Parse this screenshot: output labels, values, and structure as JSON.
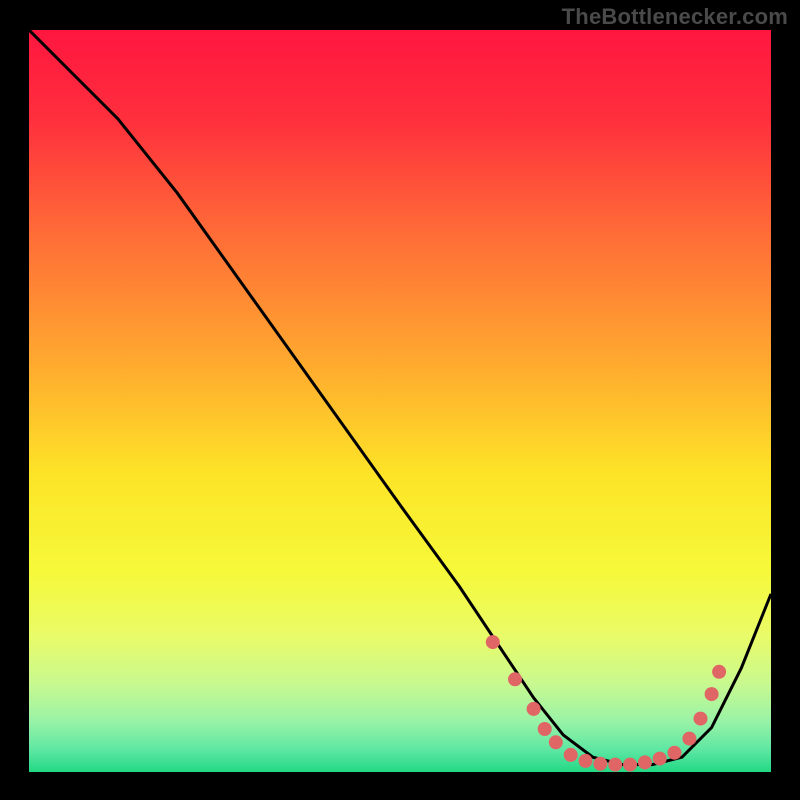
{
  "attribution": "TheBottlenecker.com",
  "chart_data": {
    "type": "line",
    "title": "",
    "xlabel": "",
    "ylabel": "",
    "xlim": [
      0,
      100
    ],
    "ylim": [
      0,
      100
    ],
    "background_gradient_stops": [
      {
        "offset": 0,
        "color": "#ff163f"
      },
      {
        "offset": 12,
        "color": "#ff2f3d"
      },
      {
        "offset": 28,
        "color": "#ff6e37"
      },
      {
        "offset": 45,
        "color": "#ffaa2f"
      },
      {
        "offset": 60,
        "color": "#fde427"
      },
      {
        "offset": 73,
        "color": "#f6f93a"
      },
      {
        "offset": 82,
        "color": "#e8fb6a"
      },
      {
        "offset": 88,
        "color": "#c9f98f"
      },
      {
        "offset": 93,
        "color": "#9bf3a6"
      },
      {
        "offset": 97,
        "color": "#5ee7a3"
      },
      {
        "offset": 100,
        "color": "#22d884"
      }
    ],
    "series": [
      {
        "name": "bottleneck-curve",
        "x": [
          0,
          6,
          12,
          20,
          30,
          40,
          50,
          58,
          64,
          68,
          72,
          76,
          80,
          84,
          88,
          92,
          96,
          100
        ],
        "y": [
          100,
          94,
          88,
          78,
          64,
          50,
          36,
          25,
          16,
          10,
          5,
          2,
          1,
          1,
          2,
          6,
          14,
          24
        ]
      }
    ],
    "markers": {
      "name": "optimal-range",
      "color": "#e06666",
      "points": [
        {
          "x": 62.5,
          "y": 17.5
        },
        {
          "x": 65.5,
          "y": 12.5
        },
        {
          "x": 68,
          "y": 8.5
        },
        {
          "x": 69.5,
          "y": 5.8
        },
        {
          "x": 71,
          "y": 4.0
        },
        {
          "x": 73,
          "y": 2.3
        },
        {
          "x": 75,
          "y": 1.5
        },
        {
          "x": 77,
          "y": 1.1
        },
        {
          "x": 79,
          "y": 1.0
        },
        {
          "x": 81,
          "y": 1.0
        },
        {
          "x": 83,
          "y": 1.3
        },
        {
          "x": 85,
          "y": 1.8
        },
        {
          "x": 87,
          "y": 2.6
        },
        {
          "x": 89,
          "y": 4.5
        },
        {
          "x": 90.5,
          "y": 7.2
        },
        {
          "x": 92,
          "y": 10.5
        },
        {
          "x": 93,
          "y": 13.5
        }
      ]
    }
  }
}
